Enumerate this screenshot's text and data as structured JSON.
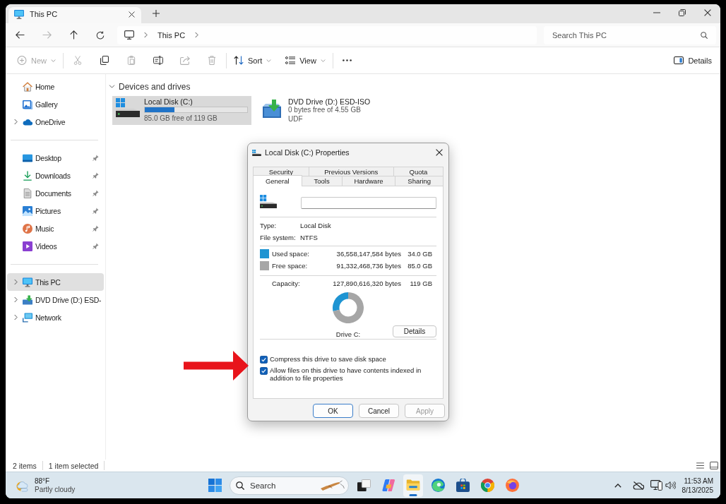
{
  "window": {
    "tabs": [
      {
        "label": "This PC",
        "selected": true
      }
    ]
  },
  "navigation": [
    {
      "kind": "back",
      "disabled": false
    },
    {
      "kind": "forward",
      "disabled": true
    },
    {
      "kind": "up",
      "disabled": false
    },
    {
      "kind": "refresh",
      "disabled": false
    }
  ],
  "address_bar": {
    "path": [
      "This PC"
    ]
  },
  "search": {
    "placeholder": "Search This PC"
  },
  "toolbar": {
    "groups": [
      {
        "items": [
          {
            "kind": "new",
            "label": "New",
            "disabled": true
          }
        ]
      },
      {
        "items": [
          {
            "kind": "cut",
            "disabled": true
          },
          {
            "kind": "copy",
            "disabled": false
          },
          {
            "kind": "paste",
            "disabled": true
          },
          {
            "kind": "rename",
            "disabled": false
          },
          {
            "kind": "share",
            "disabled": true
          },
          {
            "kind": "delete",
            "disabled": true
          }
        ]
      },
      {
        "items": [
          {
            "kind": "sort",
            "label": "Sort",
            "disabled": false
          },
          {
            "kind": "view",
            "label": "View",
            "disabled": false
          }
        ]
      },
      {
        "items": [
          {
            "kind": "more",
            "disabled": false
          }
        ]
      }
    ],
    "details": {
      "label": "Details"
    }
  },
  "sidebar": {
    "groups": [
      {
        "items": [
          {
            "kind": "home",
            "label": "Home",
            "expandable": false,
            "pinned": false,
            "selected": false
          },
          {
            "kind": "gallery",
            "label": "Gallery",
            "expandable": false,
            "pinned": false,
            "selected": false
          },
          {
            "kind": "cloud",
            "label": "OneDrive",
            "expandable": true,
            "pinned": false,
            "selected": false
          }
        ]
      },
      {
        "items": [
          {
            "kind": "desktop",
            "label": "Desktop",
            "expandable": false,
            "pinned": true,
            "selected": false
          },
          {
            "kind": "downloads",
            "label": "Downloads",
            "expandable": false,
            "pinned": true,
            "selected": false
          },
          {
            "kind": "documents",
            "label": "Documents",
            "expandable": false,
            "pinned": true,
            "selected": false
          },
          {
            "kind": "pictures",
            "label": "Pictures",
            "expandable": false,
            "pinned": true,
            "selected": false
          },
          {
            "kind": "music",
            "label": "Music",
            "expandable": false,
            "pinned": true,
            "selected": false
          },
          {
            "kind": "videos",
            "label": "Videos",
            "expandable": false,
            "pinned": true,
            "selected": false
          }
        ]
      },
      {
        "items": [
          {
            "kind": "this_pc",
            "label": "This PC",
            "expandable": true,
            "pinned": false,
            "selected": true
          },
          {
            "kind": "dvd",
            "label": "DVD Drive (D:) ESD-",
            "expandable": true,
            "pinned": false,
            "selected": false
          },
          {
            "kind": "network",
            "label": "Network",
            "expandable": true,
            "pinned": false,
            "selected": false
          }
        ]
      }
    ]
  },
  "content": {
    "section": {
      "title": "Devices and drives",
      "expanded": true,
      "drives": [
        {
          "kind": "disk",
          "name": "Local Disk (C:)",
          "level": 0.29,
          "free": "85.0 GB free of 119 GB",
          "selected": true
        },
        {
          "kind": "optical",
          "name": "DVD Drive (D:) ESD-ISO",
          "free": "0 bytes free of 4.55 GB",
          "file_system": "UDF",
          "selected": false
        }
      ]
    }
  },
  "status_bar": {
    "item_count": "2 items",
    "selection": "1 item selected"
  },
  "dialog": {
    "title": "Local Disk (C:) Properties",
    "tab_rows": [
      {
        "tabs": [
          {
            "label": "Security",
            "selected": false
          },
          {
            "label": "Previous Versions",
            "selected": false
          },
          {
            "label": "Quota",
            "selected": false
          }
        ]
      },
      {
        "tabs": [
          {
            "label": "General",
            "selected": true
          },
          {
            "label": "Tools",
            "selected": false
          },
          {
            "label": "Hardware",
            "selected": false
          },
          {
            "label": "Sharing",
            "selected": false
          }
        ]
      }
    ],
    "properties": [
      {
        "label": "Type:",
        "value": "Local Disk"
      },
      {
        "label": "File system:",
        "value": "NTFS"
      }
    ],
    "space": [
      {
        "label": "Used space:",
        "bytes": "36,558,147,584 bytes",
        "size": "34.0 GB",
        "color": "#1e94d2"
      },
      {
        "label": "Free space:",
        "bytes": "91,332,468,736 bytes",
        "size": "85.0 GB",
        "color": "#a6a6a6"
      }
    ],
    "capacity": {
      "label": "Capacity:",
      "bytes": "127,890,616,320 bytes",
      "size": "119 GB"
    },
    "chart_data": {
      "type": "donut",
      "title": "Drive C:",
      "values": [
        28.6,
        71.4
      ]
    },
    "details_button": "Details",
    "options": [
      {
        "label": "Compress this drive to save disk space",
        "checked": true
      },
      {
        "label": "Allow files on this drive to have contents indexed in addition to file properties",
        "checked": true
      }
    ],
    "buttons": [
      {
        "label": "OK",
        "default": true,
        "disabled": false
      },
      {
        "label": "Cancel",
        "default": false,
        "disabled": false
      },
      {
        "label": "Apply",
        "default": false,
        "disabled": true
      }
    ]
  },
  "taskbar": {
    "weather": {
      "temperature": "88°F",
      "condition": "Partly cloudy"
    },
    "search": {
      "placeholder": "Search"
    },
    "apps": [
      {
        "kind": "task_view",
        "active": false
      },
      {
        "kind": "copilot",
        "active": false
      },
      {
        "kind": "file_explorer",
        "active": true
      },
      {
        "kind": "edge",
        "active": false
      },
      {
        "kind": "store",
        "active": false
      },
      {
        "kind": "chrome",
        "active": false
      },
      {
        "kind": "firefox",
        "active": false
      }
    ],
    "clock": {
      "time": "11:53 AM",
      "date": "8/13/2025"
    }
  }
}
